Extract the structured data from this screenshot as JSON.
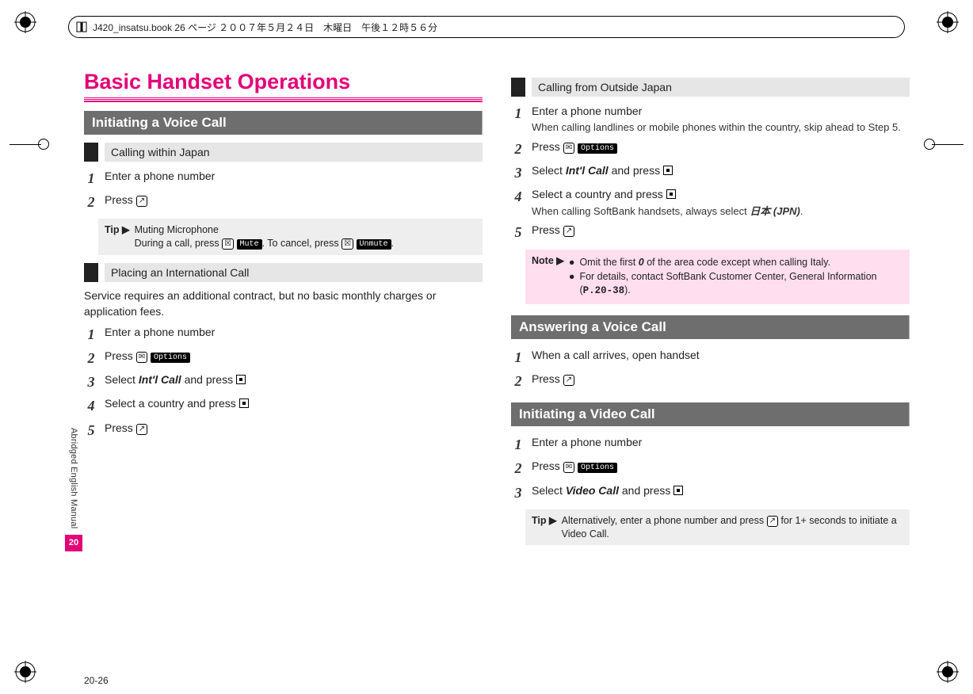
{
  "header": {
    "filename_line": "J420_insatsu.book  26 ページ  ２００７年５月２４日　木曜日　午後１２時５６分"
  },
  "side": {
    "label": "Abridged English Manual",
    "number": "20"
  },
  "page_number": "20-26",
  "chapter_title": "Basic Handset Operations",
  "sections": {
    "voice_call": "Initiating a Voice Call",
    "answer_call": "Answering a Voice Call",
    "video_call": "Initiating a Video Call"
  },
  "subs": {
    "within_japan": "Calling within Japan",
    "intl": "Placing an International Call",
    "outside_japan": "Calling from Outside Japan"
  },
  "text": {
    "intl_note": "Service requires an additional contract, but no basic monthly charges or application fees.",
    "tip_label": "Tip",
    "note_label": "Note",
    "tip_mic_title": "Muting Microphone",
    "tip_mic_p1": "During a call, press ",
    "tip_mic_p2": ". To cancel, press ",
    "tip_mic_p3": ".",
    "mute": "Mute",
    "unmute": "Unmute",
    "options": "Options",
    "intl_call": "Int'l Call",
    "video_call": "Video Call",
    "jpn": "日本 (JPN)",
    "steps": {
      "enter_number": "Enter a phone number",
      "press": "Press ",
      "select_intl": "Select ",
      "and_press": " and press ",
      "select_country": "Select a country and press ",
      "outside_sub": "When calling landlines or mobile phones within the country, skip ahead to Step 5.",
      "select_softbank": "When calling SoftBank handsets, always select ",
      "answer_open": "When a call arrives, open handset",
      "select_video": "Select "
    },
    "note_bullet1a": "Omit the first ",
    "note_bullet1b": " of the area code except when calling Italy.",
    "note_bullet2a": "For details, contact SoftBank Customer Center, General Information (",
    "note_bullet2b": ").",
    "zero": "0",
    "page_ref": "P.20-38",
    "video_tip": "Alternatively, enter a phone number and press ",
    "video_tip2": " for 1+ seconds to initiate a Video Call."
  }
}
